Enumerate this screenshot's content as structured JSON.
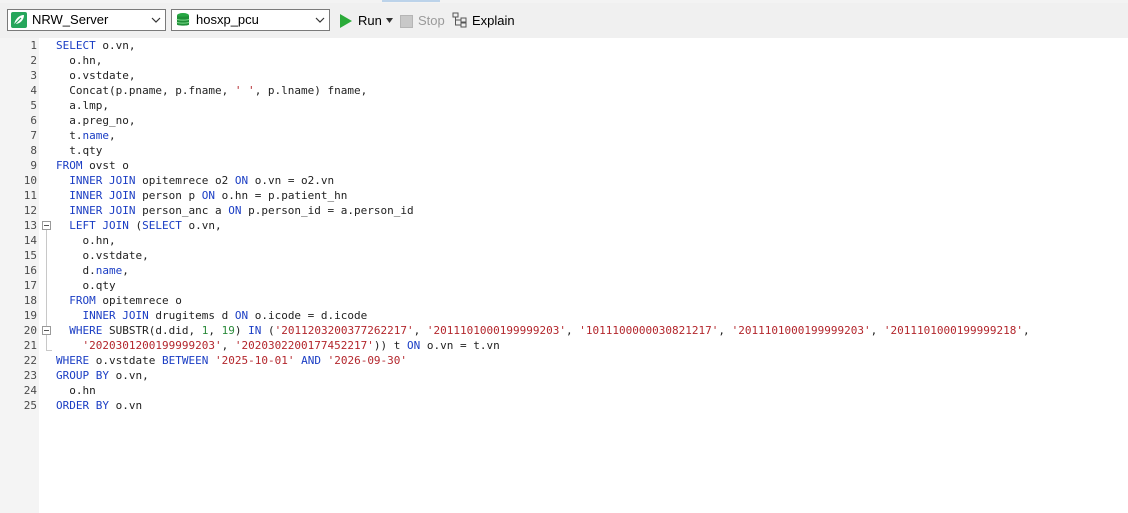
{
  "toolbar": {
    "connection": {
      "value": "NRW_Server",
      "icon": "connection-leaf-icon",
      "color": "#26a65b"
    },
    "database": {
      "value": "hosxp_pcu",
      "icon": "database-icon",
      "color": "#27a744"
    },
    "run_label": "Run",
    "stop_label": "Stop",
    "explain_label": "Explain"
  },
  "editor": {
    "line_numbers": [
      "1",
      "2",
      "3",
      "4",
      "5",
      "6",
      "7",
      "8",
      "9",
      "10",
      "11",
      "12",
      "13",
      "14",
      "15",
      "16",
      "17",
      "18",
      "19",
      "20",
      "21",
      "22",
      "23",
      "24",
      "25"
    ],
    "lines": [
      [
        {
          "t": "SELECT",
          "c": "kw"
        },
        {
          "t": " o.vn,"
        }
      ],
      [
        {
          "t": "  o.hn,"
        }
      ],
      [
        {
          "t": "  o.vstdate,"
        }
      ],
      [
        {
          "t": "  Concat(p.pname, p.fname, "
        },
        {
          "t": "' '",
          "c": "str"
        },
        {
          "t": ", p.lname) fname,"
        }
      ],
      [
        {
          "t": "  a.lmp,"
        }
      ],
      [
        {
          "t": "  a.preg_no,"
        }
      ],
      [
        {
          "t": "  t."
        },
        {
          "t": "name",
          "c": "kw"
        },
        {
          "t": ","
        }
      ],
      [
        {
          "t": "  t.qty"
        }
      ],
      [
        {
          "t": "FROM",
          "c": "kw"
        },
        {
          "t": " ovst o"
        }
      ],
      [
        {
          "t": "  "
        },
        {
          "t": "INNER JOIN",
          "c": "kw"
        },
        {
          "t": " opitemrece o2 "
        },
        {
          "t": "ON",
          "c": "kw"
        },
        {
          "t": " o.vn = o2.vn"
        }
      ],
      [
        {
          "t": "  "
        },
        {
          "t": "INNER JOIN",
          "c": "kw"
        },
        {
          "t": " person p "
        },
        {
          "t": "ON",
          "c": "kw"
        },
        {
          "t": " o.hn = p.patient_hn"
        }
      ],
      [
        {
          "t": "  "
        },
        {
          "t": "INNER JOIN",
          "c": "kw"
        },
        {
          "t": " person_anc a "
        },
        {
          "t": "ON",
          "c": "kw"
        },
        {
          "t": " p.person_id = a.person_id"
        }
      ],
      [
        {
          "t": "  "
        },
        {
          "t": "LEFT JOIN",
          "c": "kw"
        },
        {
          "t": " ("
        },
        {
          "t": "SELECT",
          "c": "kw"
        },
        {
          "t": " o.vn,"
        }
      ],
      [
        {
          "t": "    o.hn,"
        }
      ],
      [
        {
          "t": "    o.vstdate,"
        }
      ],
      [
        {
          "t": "    d."
        },
        {
          "t": "name",
          "c": "kw"
        },
        {
          "t": ","
        }
      ],
      [
        {
          "t": "    o.qty"
        }
      ],
      [
        {
          "t": "  "
        },
        {
          "t": "FROM",
          "c": "kw"
        },
        {
          "t": " opitemrece o"
        }
      ],
      [
        {
          "t": "    "
        },
        {
          "t": "INNER JOIN",
          "c": "kw"
        },
        {
          "t": " drugitems d "
        },
        {
          "t": "ON",
          "c": "kw"
        },
        {
          "t": " o.icode = d.icode"
        }
      ],
      [
        {
          "t": "  "
        },
        {
          "t": "WHERE",
          "c": "kw"
        },
        {
          "t": " SUBSTR(d.did, "
        },
        {
          "t": "1",
          "c": "num"
        },
        {
          "t": ", "
        },
        {
          "t": "19",
          "c": "num"
        },
        {
          "t": ") "
        },
        {
          "t": "IN",
          "c": "kw"
        },
        {
          "t": " ("
        },
        {
          "t": "'2011203200377262217'",
          "c": "str"
        },
        {
          "t": ", "
        },
        {
          "t": "'2011101000199999203'",
          "c": "str"
        },
        {
          "t": ", "
        },
        {
          "t": "'1011100000030821217'",
          "c": "str"
        },
        {
          "t": ", "
        },
        {
          "t": "'2011101000199999203'",
          "c": "str"
        },
        {
          "t": ", "
        },
        {
          "t": "'2011101000199999218'",
          "c": "str"
        },
        {
          "t": ","
        }
      ],
      [
        {
          "t": "    "
        },
        {
          "t": "'2020301200199999203'",
          "c": "str"
        },
        {
          "t": ", "
        },
        {
          "t": "'2020302200177452217'",
          "c": "str"
        },
        {
          "t": ")) t "
        },
        {
          "t": "ON",
          "c": "kw"
        },
        {
          "t": " o.vn = t.vn"
        }
      ],
      [
        {
          "t": "WHERE",
          "c": "kw"
        },
        {
          "t": " o.vstdate "
        },
        {
          "t": "BETWEEN",
          "c": "kw"
        },
        {
          "t": " "
        },
        {
          "t": "'2025-10-01'",
          "c": "str"
        },
        {
          "t": " "
        },
        {
          "t": "AND",
          "c": "kw"
        },
        {
          "t": " "
        },
        {
          "t": "'2026-09-30'",
          "c": "str"
        }
      ],
      [
        {
          "t": "GROUP BY",
          "c": "kw"
        },
        {
          "t": " o.vn,"
        }
      ],
      [
        {
          "t": "  o.hn"
        }
      ],
      [
        {
          "t": "ORDER BY",
          "c": "kw"
        },
        {
          "t": " o.vn"
        }
      ]
    ]
  }
}
